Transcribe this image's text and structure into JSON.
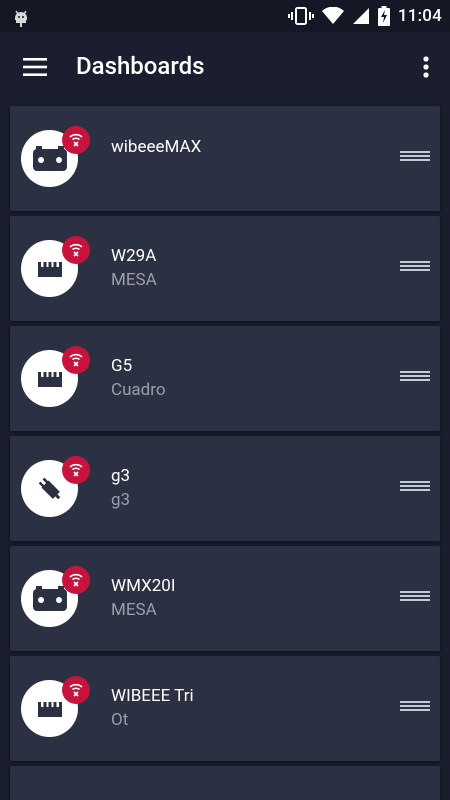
{
  "status_bar": {
    "time": "11:04"
  },
  "app_bar": {
    "title": "Dashboards"
  },
  "dashboards": [
    {
      "name": "wibeeeMAX",
      "location": "",
      "icon": "meter-device-icon"
    },
    {
      "name": "W29A",
      "location": "MESA",
      "icon": "clamp-device-icon"
    },
    {
      "name": "G5",
      "location": "Cuadro",
      "icon": "clamp-device-icon"
    },
    {
      "name": "g3",
      "location": "g3",
      "icon": "plug-device-icon"
    },
    {
      "name": "WMX20I",
      "location": "MESA",
      "icon": "meter-device-icon"
    },
    {
      "name": "WIBEEE Tri",
      "location": "Ot",
      "icon": "clamp-device-icon"
    }
  ],
  "colors": {
    "background": "#1a1d2b",
    "card": "#2c3043",
    "badge": "#c8143c",
    "subtext": "#9a9daa"
  }
}
